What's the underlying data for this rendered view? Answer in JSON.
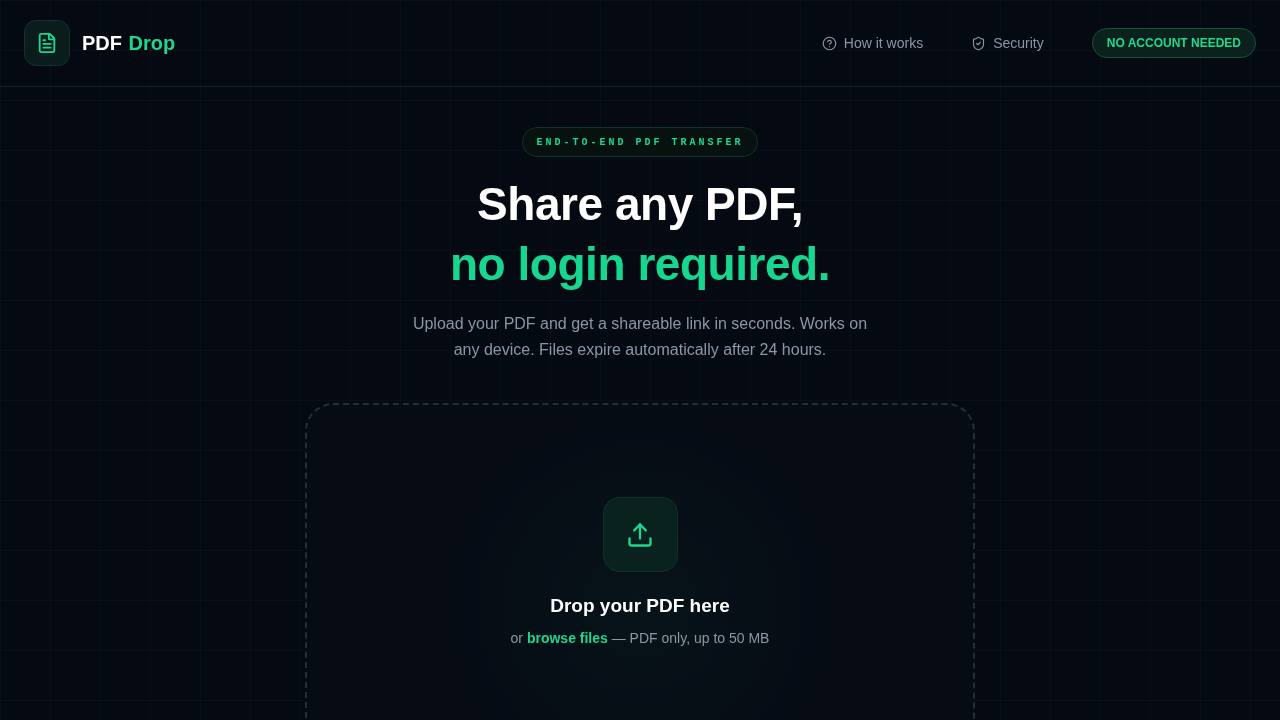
{
  "header": {
    "brand": {
      "name": "PDF",
      "accent": "Drop"
    },
    "nav": [
      {
        "label": "How it works",
        "kind": "guide"
      },
      {
        "label": "Security",
        "kind": "security"
      }
    ],
    "badge": "NO ACCOUNT NEEDED"
  },
  "hero": {
    "eyebrow": "END-TO-END PDF TRANSFER",
    "headline": {
      "line_1": "Share any PDF,",
      "line_2": "no login required."
    },
    "description": "Upload your PDF and get a shareable link in seconds. Works on any device. Files expire automatically after 24 hours."
  },
  "dropzone": {
    "title": "Drop your PDF here",
    "hint": {
      "prefix": "or",
      "link": "browse files",
      "suffix": "— PDF only, up to 50 MB"
    }
  }
}
